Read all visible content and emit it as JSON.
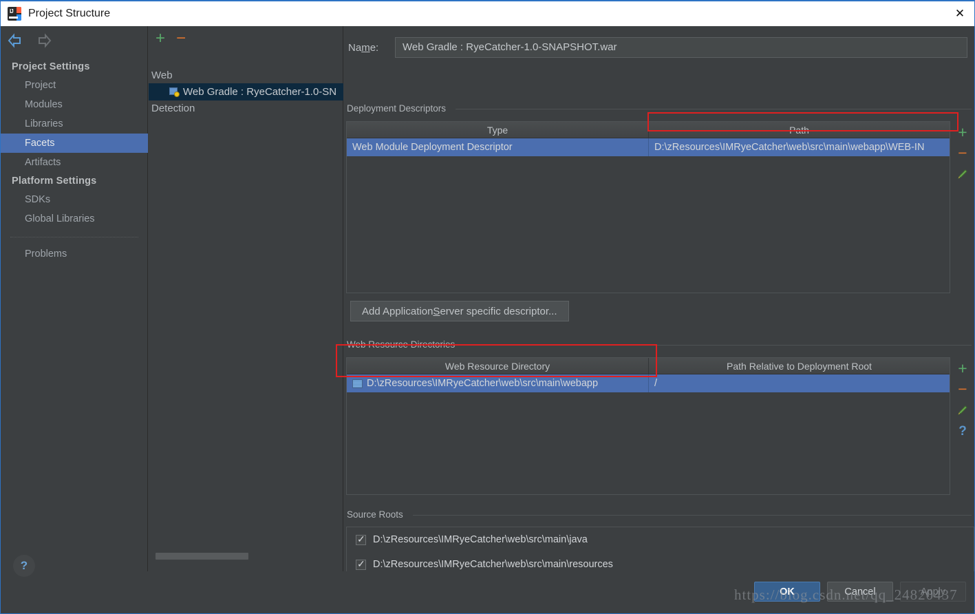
{
  "window": {
    "title": "Project Structure",
    "app_icon": "intellij-idea-icon",
    "close_label": "✕"
  },
  "sidebar": {
    "back_icon": "back-arrow-icon",
    "forward_icon": "forward-arrow-icon",
    "help_label": "?",
    "groups": [
      {
        "label": "Project Settings",
        "items": [
          {
            "label": "Project",
            "selected": false
          },
          {
            "label": "Modules",
            "selected": false
          },
          {
            "label": "Libraries",
            "selected": false
          },
          {
            "label": "Facets",
            "selected": true
          },
          {
            "label": "Artifacts",
            "selected": false
          }
        ]
      },
      {
        "label": "Platform Settings",
        "items": [
          {
            "label": "SDKs",
            "selected": false
          },
          {
            "label": "Global Libraries",
            "selected": false
          }
        ]
      }
    ],
    "problems_label": "Problems"
  },
  "tree": {
    "add_label": "+",
    "remove_label": "−",
    "root_label": "Web",
    "child_label": "Web Gradle : RyeCatcher-1.0-SN",
    "child_icon": "web-module-icon",
    "detection_label": "Detection"
  },
  "main": {
    "name_label_pre": "Na",
    "name_label_mnemonic": "m",
    "name_label_post": "e:",
    "name_value": "Web Gradle : RyeCatcher-1.0-SNAPSHOT.war",
    "deployment_descriptors": {
      "title": "Deployment Descriptors",
      "columns": [
        "Type",
        "Path"
      ],
      "rows": [
        {
          "type": "Web Module Deployment Descriptor",
          "path": "D:\\zResources\\IMRyeCatcher\\web\\src\\main\\webapp\\WEB-IN",
          "selected": true
        }
      ],
      "toolbar": [
        {
          "icon": "plus-icon",
          "label": "+"
        },
        {
          "icon": "minus-icon",
          "label": "−"
        },
        {
          "icon": "pencil-icon",
          "label": ""
        }
      ]
    },
    "add_descriptor_button": {
      "pre": "Add Application ",
      "mnemonic": "S",
      "post": "erver specific descriptor..."
    },
    "web_resource_directories": {
      "title": "Web Resource Directories",
      "columns": [
        "Web Resource Directory",
        "Path Relative to Deployment Root"
      ],
      "rows": [
        {
          "directory": "D:\\zResources\\IMRyeCatcher\\web\\src\\main\\webapp",
          "relative_path": "/",
          "icon": "folder-icon",
          "selected": true
        }
      ],
      "toolbar": [
        {
          "icon": "plus-icon",
          "label": "+"
        },
        {
          "icon": "minus-icon",
          "label": "−"
        },
        {
          "icon": "pencil-icon",
          "label": ""
        },
        {
          "icon": "help-icon",
          "label": "?"
        }
      ]
    },
    "source_roots": {
      "title": "Source Roots",
      "rows": [
        {
          "label": "D:\\zResources\\IMRyeCatcher\\web\\src\\main\\java",
          "checked": true
        },
        {
          "label": "D:\\zResources\\IMRyeCatcher\\web\\src\\main\\resources",
          "checked": true
        }
      ]
    }
  },
  "footer": {
    "ok_label": "OK",
    "cancel_label": "Cancel",
    "apply_label": "Apply"
  },
  "watermark": "https://blog.csdn.net/qq_24820437",
  "colors": {
    "background": "#3c3f41",
    "selection_blue": "#4b6eaf",
    "tree_selection": "#0d293e",
    "accent_green": "#59a869",
    "accent_orange": "#d9722e",
    "annotation_red": "#e02020",
    "titlebar": "#ffffff"
  }
}
